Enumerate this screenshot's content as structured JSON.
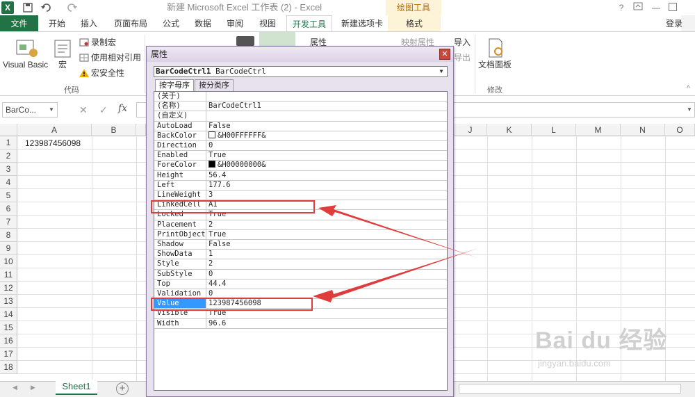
{
  "window": {
    "title": "新建 Microsoft Excel 工作表 (2) - Excel",
    "contextual_tab": "绘图工具",
    "login": "登录",
    "help": "?",
    "minimize": "—",
    "close": "✕"
  },
  "ribbon": {
    "tabs": [
      "文件",
      "开始",
      "插入",
      "页面布局",
      "公式",
      "数据",
      "审阅",
      "视图",
      "开发工具",
      "新建选项卡",
      "格式"
    ],
    "active_tab": "开发工具",
    "visual_basic": "Visual Basic",
    "macros": "宏",
    "record_macro": "录制宏",
    "relative_ref": "使用相对引用",
    "macro_security": "宏安全性",
    "group_code": "代码",
    "map_props": "映射属性",
    "import": "导入",
    "export": "导出",
    "doc_panel": "文档面板",
    "group_modify": "修改",
    "properties_btn": "属性"
  },
  "formula_bar": {
    "name_box": "BarCo...",
    "fx": "fx"
  },
  "grid": {
    "columns_left": [
      "A",
      "B"
    ],
    "columns_right": [
      "J",
      "K",
      "L",
      "M",
      "N",
      "O"
    ],
    "rows": [
      "1",
      "2",
      "3",
      "4",
      "5",
      "6",
      "7",
      "8",
      "9",
      "10",
      "11",
      "12",
      "13",
      "14",
      "15",
      "16",
      "17",
      "18"
    ],
    "cell_a1": "123987456098"
  },
  "sheets": {
    "active": "Sheet1",
    "add": "+"
  },
  "dialog": {
    "title": "属性",
    "object_name": "BarCodeCtrl1",
    "object_type": "BarCodeCtrl",
    "tab_alpha": "按字母序",
    "tab_category": "按分类序",
    "properties": [
      {
        "name": "(关于)",
        "value": ""
      },
      {
        "name": "(名称)",
        "value": "BarCodeCtrl1"
      },
      {
        "name": "(自定义)",
        "value": ""
      },
      {
        "name": "AutoLoad",
        "value": "False"
      },
      {
        "name": "BackColor",
        "value": "&H00FFFFFF&",
        "swatch": "#ffffff"
      },
      {
        "name": "Direction",
        "value": "0"
      },
      {
        "name": "Enabled",
        "value": "True"
      },
      {
        "name": "ForeColor",
        "value": "&H00000000&",
        "swatch": "#000000"
      },
      {
        "name": "Height",
        "value": "56.4"
      },
      {
        "name": "Left",
        "value": "177.6"
      },
      {
        "name": "LineWeight",
        "value": "3"
      },
      {
        "name": "LinkedCell",
        "value": "A1"
      },
      {
        "name": "Locked",
        "value": "True"
      },
      {
        "name": "Placement",
        "value": "2"
      },
      {
        "name": "PrintObject",
        "value": "True"
      },
      {
        "name": "Shadow",
        "value": "False"
      },
      {
        "name": "ShowData",
        "value": "1"
      },
      {
        "name": "Style",
        "value": "2"
      },
      {
        "name": "SubStyle",
        "value": "0"
      },
      {
        "name": "Top",
        "value": "44.4"
      },
      {
        "name": "Validation",
        "value": "0"
      },
      {
        "name": "Value",
        "value": "123987456098",
        "selected": true
      },
      {
        "name": "Visible",
        "value": "True"
      },
      {
        "name": "Width",
        "value": "96.6"
      }
    ]
  },
  "watermark": {
    "brand": "Bai du 经验",
    "url": "jingyan.baidu.com"
  },
  "colors": {
    "excel_green": "#217346",
    "annotation_red": "#e03c3c",
    "selection_blue": "#3399ff"
  }
}
